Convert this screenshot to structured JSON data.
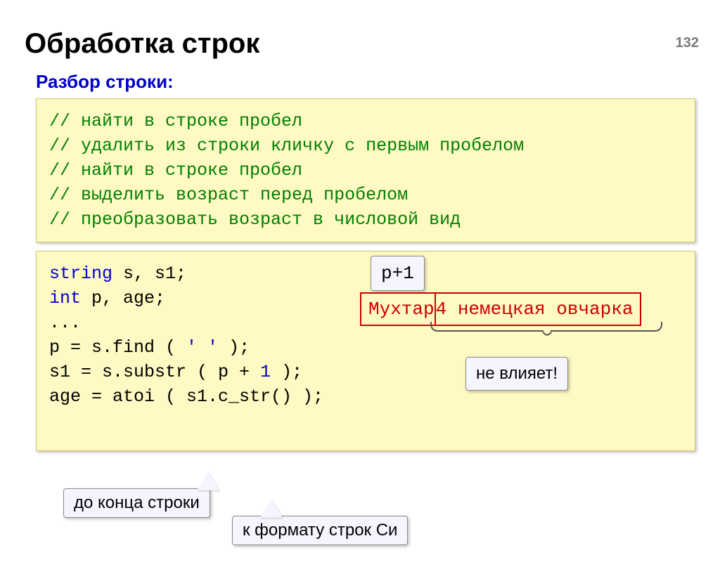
{
  "page_number": "132",
  "title": "Обработка строк",
  "subtitle": "Разбор строки:",
  "comments": {
    "c1": "// найти в строке пробел",
    "c2": "// удалить из строки кличку с первым пробелом",
    "c3": "// найти в строке пробел",
    "c4": "// выделить возраст перед пробелом",
    "c5": "// преобразовать возраст в числовой вид"
  },
  "code": {
    "kw_string": "string",
    "decl1": " s, s1;",
    "kw_int": "int",
    "decl2": " p, age;",
    "ellipsis": "...",
    "l4a": "p = s.find ( ",
    "l4b": "' '",
    "l4c": " );",
    "l5a": "s1 = s.substr ( p + ",
    "l5b": "1",
    "l5c": " );",
    "l6": "age = atoi ( s1.c_str() );"
  },
  "annotations": {
    "p_plus_1": "p+1",
    "example_left": "Мухтар",
    "example_right": " 4 немецкая овчарка",
    "no_effect": "не влияет!",
    "to_end": "до конца строки",
    "c_format": "к формату строк Си"
  }
}
